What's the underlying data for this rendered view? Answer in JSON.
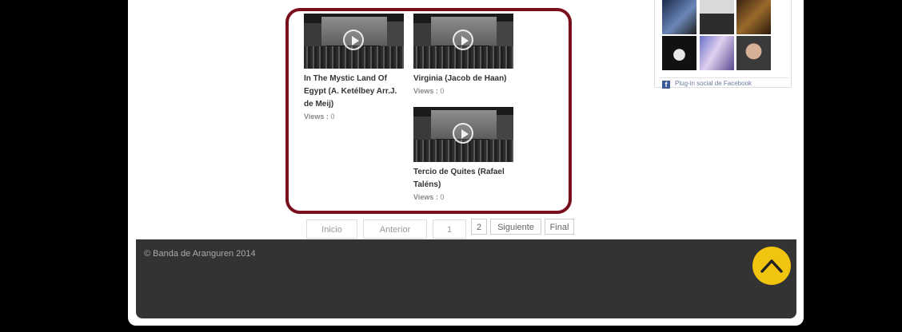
{
  "videos": [
    {
      "title": "In The Mystic Land Of Egypt (A. Ketélbey Arr.J. de Meij)",
      "views_label": "Views :",
      "views_count": "0"
    },
    {
      "title": "Virginia (Jacob de Haan)",
      "views_label": "Views :",
      "views_count": "0"
    },
    {
      "title": "Tercio de Quites (Rafael Taléns)",
      "views_label": "Views :",
      "views_count": "0"
    }
  ],
  "pagination": {
    "start": "Inicio",
    "previous": "Anterior",
    "current_page": "1",
    "next_page": "2",
    "next": "Siguiente",
    "last": "Final"
  },
  "facebook": {
    "plugin_text": "Plug-in social de Facebook",
    "logo": "f"
  },
  "footer": {
    "copyright": "© Banda de Aranguren 2014"
  },
  "icons": {
    "play": "play-icon",
    "back_to_top": "chevron-up-icon"
  },
  "colors": {
    "accent_border": "#7a0e1c",
    "back_to_top": "#f1c40f",
    "footer_bg": "#333333",
    "facebook_blue": "#3b5998"
  }
}
